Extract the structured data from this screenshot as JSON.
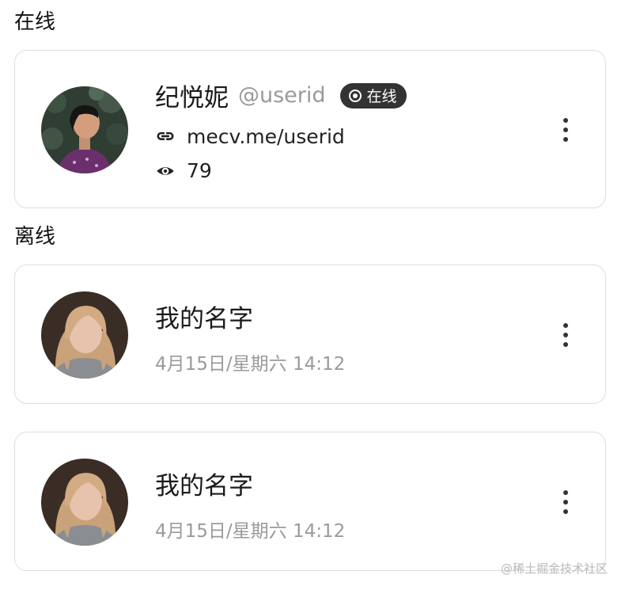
{
  "sections": {
    "online_title": "在线",
    "offline_title": "离线"
  },
  "online_user": {
    "name": "纪悦妮",
    "handle": "@userid",
    "status_badge": "在线",
    "link": "mecv.me/userid",
    "views": "79",
    "icons": [
      "link-icon",
      "eye-icon",
      "more-vertical-icon",
      "status-dot-icon"
    ]
  },
  "offline_users": [
    {
      "name": "我的名字",
      "timestamp": "4月15日/星期六 14:12"
    },
    {
      "name": "我的名字",
      "timestamp": "4月15日/星期六 14:12"
    }
  ],
  "watermark": "@稀土掘金技术社区",
  "colors": {
    "badge_bg": "#333333",
    "muted_text": "#9a9a9a",
    "card_border": "#dedede"
  }
}
